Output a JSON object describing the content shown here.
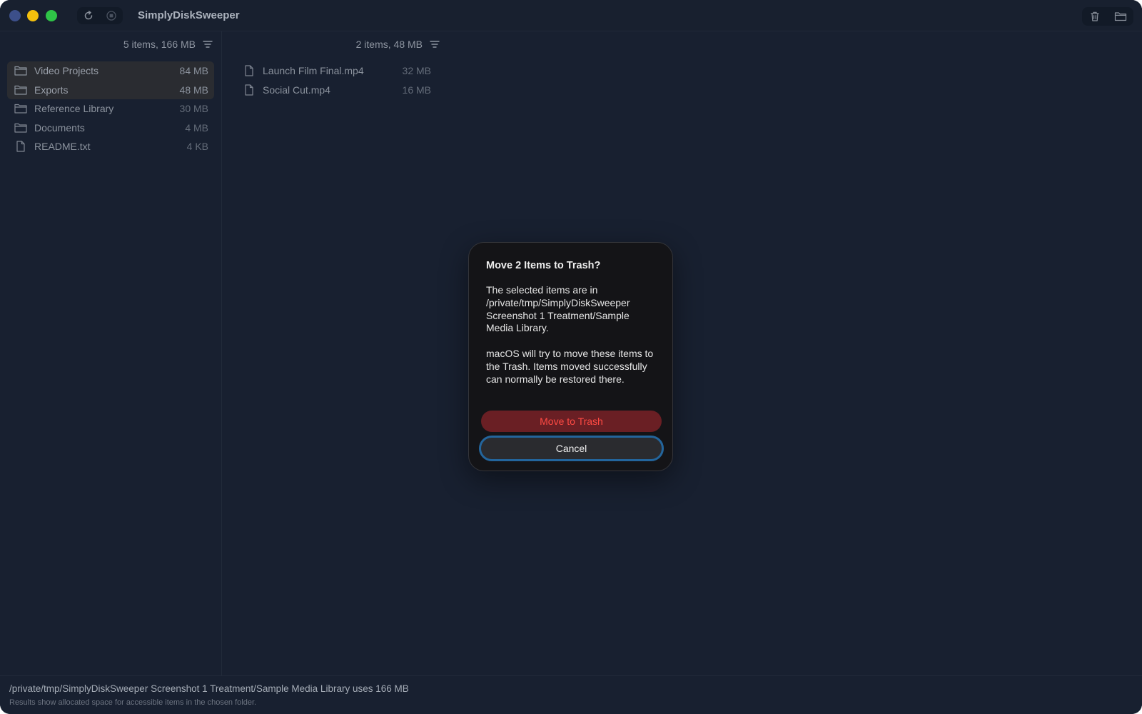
{
  "app": {
    "title": "SimplyDiskSweeper"
  },
  "toolbar": {
    "refresh_icon": "refresh-icon",
    "stop_icon": "stop-icon",
    "trash_icon": "trash-icon",
    "folder_icon": "folder-icon"
  },
  "left_column": {
    "summary": "5 items, 166 MB",
    "items": [
      {
        "type": "folder",
        "name": "Video Projects",
        "size": "84 MB",
        "selected": true
      },
      {
        "type": "folder",
        "name": "Exports",
        "size": "48 MB",
        "selected": true
      },
      {
        "type": "folder",
        "name": "Reference Library",
        "size": "30 MB",
        "selected": false
      },
      {
        "type": "folder",
        "name": "Documents",
        "size": "4 MB",
        "selected": false
      },
      {
        "type": "file",
        "name": "README.txt",
        "size": "4 KB",
        "selected": false
      }
    ]
  },
  "right_column": {
    "summary": "2 items, 48 MB",
    "items": [
      {
        "type": "file",
        "name": "Launch Film Final.mp4",
        "size": "32 MB"
      },
      {
        "type": "file",
        "name": "Social Cut.mp4",
        "size": "16 MB"
      }
    ]
  },
  "footer": {
    "usage": "/private/tmp/SimplyDiskSweeper Screenshot 1 Treatment/Sample Media Library uses 166 MB",
    "note": "Results show allocated space for accessible items in the chosen folder."
  },
  "dialog": {
    "title": "Move 2 Items to Trash?",
    "message1": "The selected items are in /private/tmp/SimplyDiskSweeper Screenshot 1 Treatment/Sample Media Library.",
    "message2": "macOS will try to move these items to the Trash. Items moved successfully can normally be restored there.",
    "confirm_label": "Move to Trash",
    "cancel_label": "Cancel"
  },
  "colors": {
    "window_bg": "#182030",
    "destructive": "#ff4a43",
    "focus_ring": "#23659c"
  }
}
